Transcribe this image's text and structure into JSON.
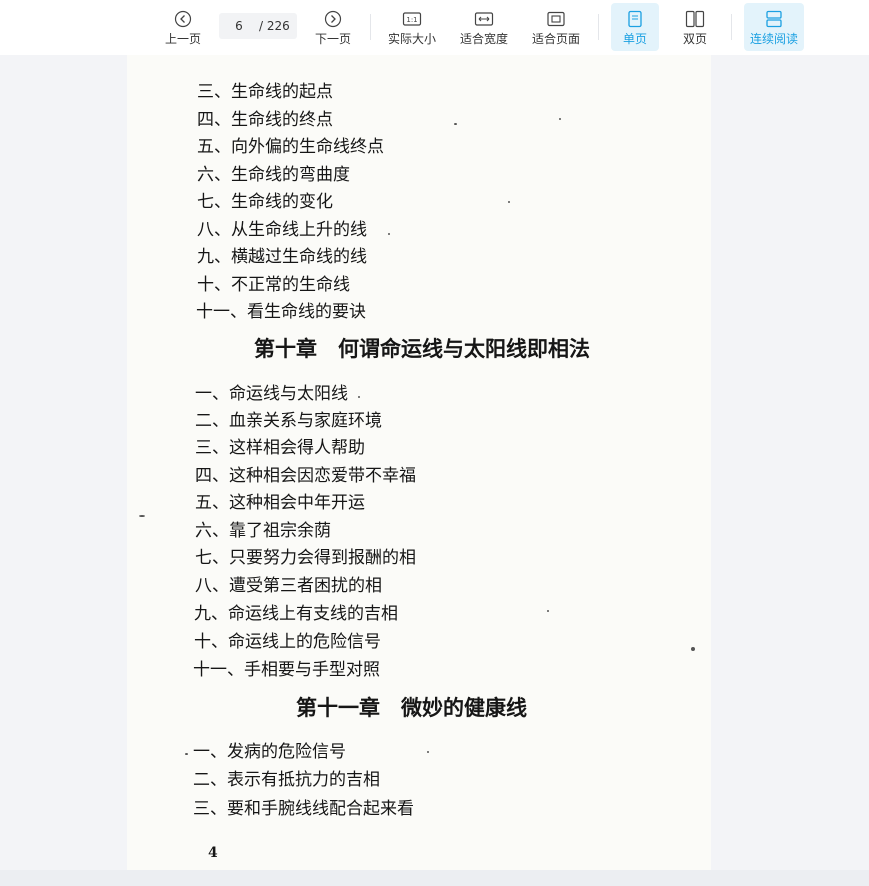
{
  "toolbar": {
    "prev_label": "上一页",
    "next_label": "下一页",
    "current_page": "6",
    "total_pages": "/ 226",
    "actual_size_label": "实际大小",
    "fit_width_label": "适合宽度",
    "fit_page_label": "适合页面",
    "single_page_label": "单页",
    "double_page_label": "双页",
    "continuous_label": "连续阅读"
  },
  "page": {
    "lines_ch9": [
      "三、生命线的起点",
      "四、生命线的终点",
      "五、向外偏的生命线终点",
      "六、生命线的弯曲度",
      "七、生命线的变化",
      "八、从生命线上升的线",
      "九、横越过生命线的线",
      "十、不正常的生命线",
      "十一、看生命线的要诀"
    ],
    "chapter10_title": "第十章　何谓命运线与太阳线即相法",
    "lines_ch10": [
      "一、命运线与太阳线",
      "二、血亲关系与家庭环境",
      "三、这样相会得人帮助",
      "四、这种相会因恋爱带不幸福",
      "五、这种相会中年开运",
      "六、靠了祖宗余荫",
      "七、只要努力会得到报酬的相",
      "八、遭受第三者困扰的相",
      "九、命运线上有支线的吉相",
      "十、命运线上的危险信号",
      "十一、手相要与手型对照"
    ],
    "chapter11_title": "第十一章　微妙的健康线",
    "lines_ch11": [
      "一、发病的危险信号",
      "二、表示有抵抗力的吉相",
      "三、要和手腕线线配合起来看"
    ],
    "page_number": "4"
  },
  "colors": {
    "accent": "#1ba0e2",
    "active_bg": "#e3f3fb"
  }
}
